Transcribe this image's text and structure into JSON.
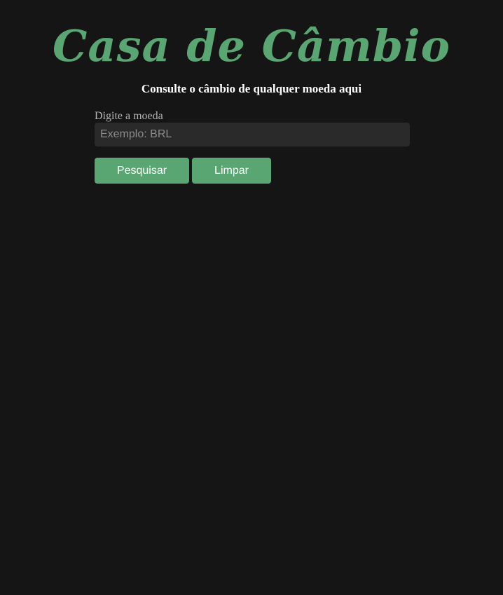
{
  "header": {
    "title": "Casa de Câmbio",
    "subtitle": "Consulte o câmbio de qualquer moeda aqui"
  },
  "form": {
    "label": "Digite a moeda",
    "input_value": "",
    "input_placeholder": "Exemplo: BRL",
    "search_label": "Pesquisar",
    "clear_label": "Limpar"
  },
  "colors": {
    "background": "#151515",
    "accent": "#5aa672",
    "input_background": "#2a2a2a",
    "text": "#ffffff"
  }
}
